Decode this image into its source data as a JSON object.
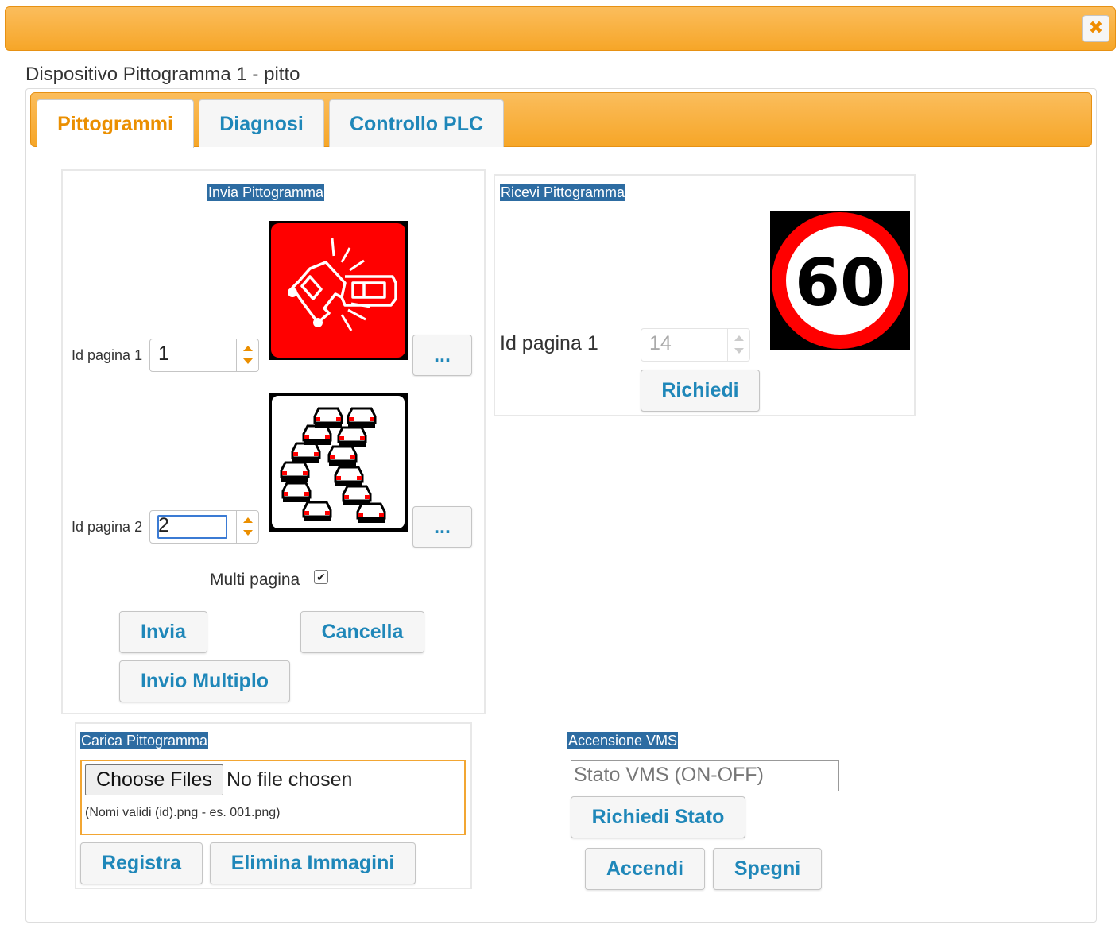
{
  "window": {
    "close_icon": "close-icon",
    "title": "Dispositivo Pittogramma 1 - pitto"
  },
  "tabs": [
    {
      "label": "Pittogrammi",
      "active": true
    },
    {
      "label": "Diagnosi",
      "active": false
    },
    {
      "label": "Controllo PLC",
      "active": false
    }
  ],
  "invia": {
    "legend": "Invia Pittogramma",
    "page1": {
      "label": "Id pagina 1",
      "value": "1",
      "browse_label": "...",
      "pictogram": "car-crash-pictogram"
    },
    "page2": {
      "label": "Id pagina 2",
      "value": "2",
      "browse_label": "...",
      "pictogram": "traffic-jam-pictogram"
    },
    "multi_label": "Multi pagina",
    "multi_checked": true,
    "send_label": "Invia",
    "cancel_label": "Cancella",
    "multi_send_label": "Invio Multiplo"
  },
  "ricevi": {
    "legend": "Ricevi Pittogramma",
    "page_label": "Id pagina 1",
    "page_value": "14",
    "request_label": "Richiedi",
    "pictogram": "speed-limit-sign",
    "sign_text": "60"
  },
  "carica": {
    "legend": "Carica Pittogramma",
    "choose_label": "Choose Files",
    "file_status": "No file chosen",
    "hint": "(Nomi validi (id).png - es. 001.png)",
    "register_label": "Registra",
    "delete_label": "Elimina Immagini"
  },
  "vms": {
    "legend": "Accensione VMS",
    "status_placeholder": "Stato VMS (ON-OFF)",
    "request_status_label": "Richiedi Stato",
    "on_label": "Accendi",
    "off_label": "Spegni"
  },
  "colors": {
    "accent": "#f6a628",
    "link": "#1f87b9",
    "legend_bg": "#2d6ca2",
    "active_tab": "#eb8f00"
  }
}
